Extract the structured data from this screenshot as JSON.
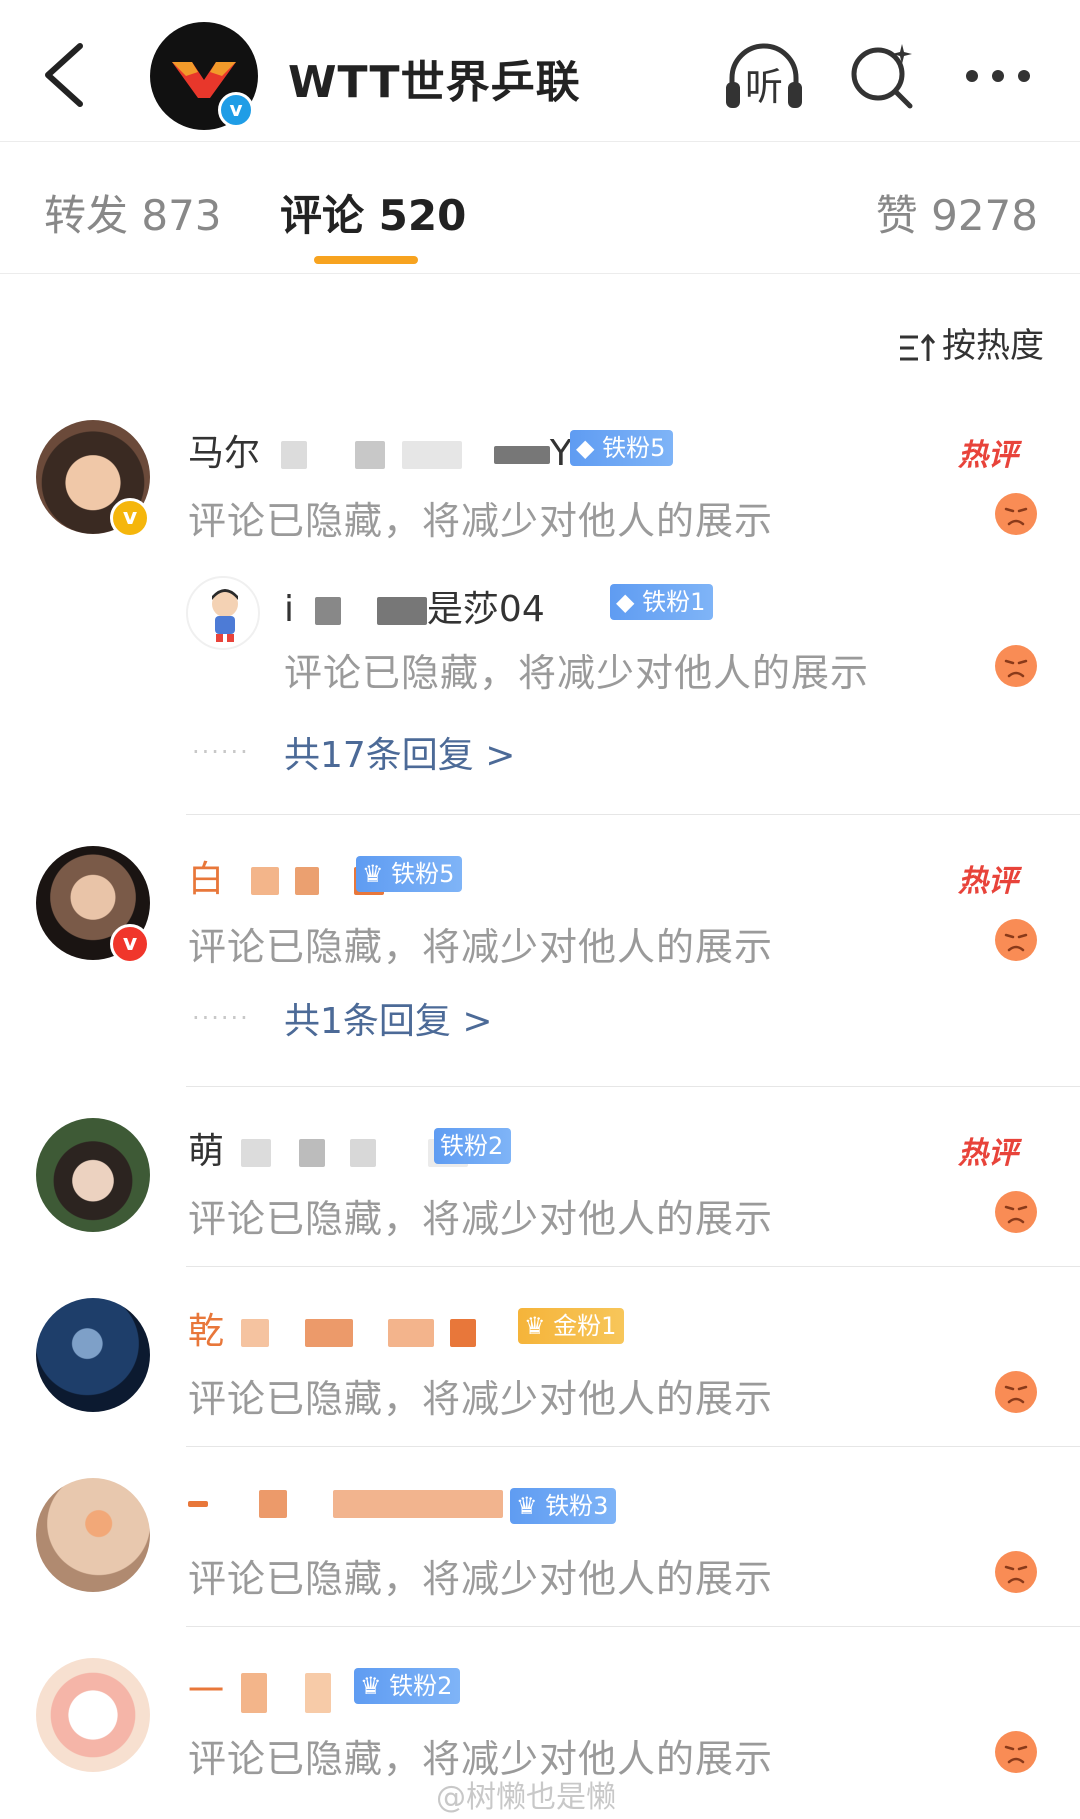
{
  "header": {
    "account_name": "WTT世界乒联",
    "verified_badge": "v",
    "listen_label": "听",
    "icons": [
      "back-arrow-icon",
      "listen-headphone-icon",
      "search-sparkle-icon",
      "more-icon"
    ]
  },
  "tabs": [
    {
      "label": "转发 873",
      "active": false
    },
    {
      "label": "评论 520",
      "active": true
    },
    {
      "label": "赞 9278",
      "active": false
    }
  ],
  "sort": {
    "label": "按热度"
  },
  "hidden_text": "评论已隐藏，将减少对他人的展示",
  "hot_label": "热评",
  "comments": [
    {
      "name_start": "马尔",
      "name_end": "YS",
      "fan_badge": "铁粉5",
      "hot": true,
      "avatar_badge": "v",
      "reply": {
        "name_start": "i",
        "name_end": "是莎04",
        "fan_badge": "铁粉1"
      },
      "reply_link": "共17条回复 >"
    },
    {
      "name_start": "白",
      "name_end": "",
      "fan_badge": "铁粉5",
      "hot": true,
      "avatar_badge": "v",
      "reply_link": "共1条回复 >"
    },
    {
      "name_start": "萌",
      "name_end": "",
      "fan_badge": "铁粉2",
      "hot": true
    },
    {
      "name_start": "乾",
      "name_end": "",
      "fan_badge": "金粉1",
      "hot": false
    },
    {
      "name_start": "",
      "name_end": "",
      "fan_badge": "铁粉3",
      "hot": false
    },
    {
      "name_start": "一",
      "name_end": "",
      "fan_badge": "铁粉2",
      "hot": false
    }
  ],
  "watermark": "@树懒也是懒",
  "colors": {
    "accent": "#f7a31f",
    "link": "#4c6a97",
    "hot": "#e8433a",
    "fan_blue": "#6aa6f5",
    "orange_name": "#e8773a"
  }
}
